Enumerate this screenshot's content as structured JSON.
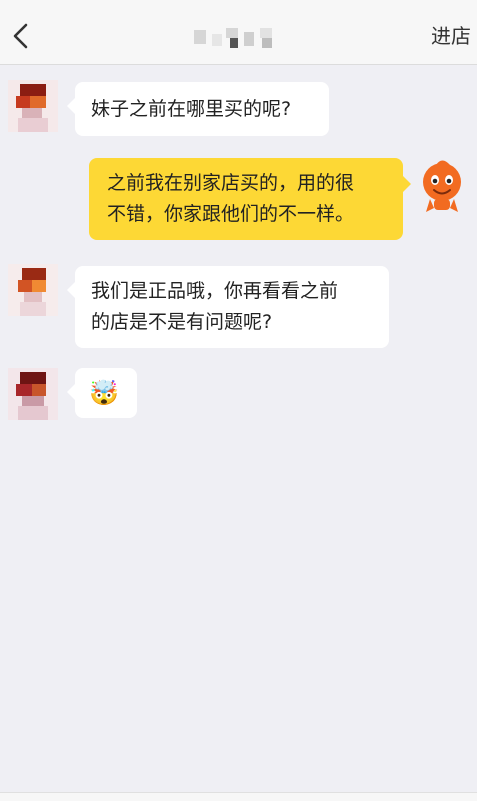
{
  "header": {
    "back_icon": "chevron-left-icon",
    "title_masked": true,
    "action_label": "进店"
  },
  "messages": [
    {
      "side": "left",
      "text": "妹子之前在哪里买的呢?"
    },
    {
      "side": "right",
      "lines": [
        "之前我在别家店买的，用的很",
        "不错，你家跟他们的不一样。"
      ]
    },
    {
      "side": "left",
      "lines": [
        "我们是正品哦，你再看看之前",
        "的店是不是有问题呢?"
      ]
    },
    {
      "side": "left",
      "emoji": "🤯"
    }
  ],
  "colors": {
    "background": "#efeff4",
    "bubble_self": "#fdd835",
    "bubble_other": "#ffffff",
    "mascot": "#f26b21"
  }
}
